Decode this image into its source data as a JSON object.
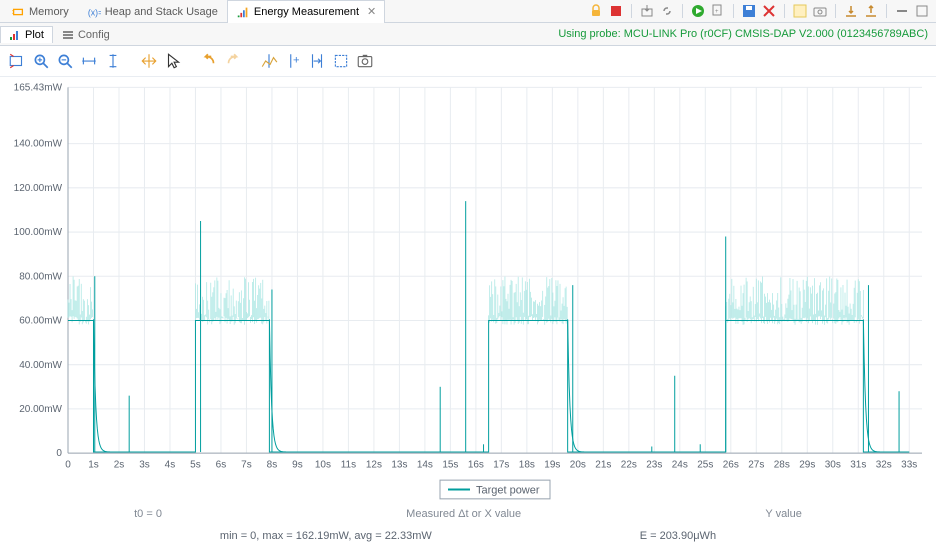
{
  "viewTabs": {
    "memory": "Memory",
    "heap": "Heap and Stack Usage",
    "energy": "Energy Measurement"
  },
  "innerTabs": {
    "plot": "Plot",
    "config": "Config"
  },
  "probe_status": "Using probe: MCU-LINK Pro (r0CF) CMSIS-DAP V2.000 (0123456789ABC)",
  "stats": {
    "t0": "t0 = 0",
    "measured": "Measured Δt or X value",
    "yvalue": "Y value",
    "range": "min = 0, max = 162.19mW, avg = 22.33mW",
    "energy": "E = 203.90μWh"
  },
  "legend": "Target power",
  "chart_data": {
    "type": "line",
    "title": "",
    "xlabel": "",
    "ylabel": "",
    "x_unit": "s",
    "y_unit": "mW",
    "xlim": [
      0,
      33.5
    ],
    "ylim": [
      0,
      165.43
    ],
    "yticks": [
      0,
      20.0,
      40.0,
      60.0,
      80.0,
      100.0,
      120.0,
      140.0,
      165.43
    ],
    "ytick_labels": [
      "0",
      "20.00mW",
      "40.00mW",
      "60.00mW",
      "80.00mW",
      "100.00mW",
      "120.00mW",
      "140.00mW",
      "165.43mW"
    ],
    "xticks": [
      0,
      1,
      2,
      3,
      4,
      5,
      6,
      7,
      8,
      9,
      10,
      11,
      12,
      13,
      14,
      15,
      16,
      17,
      18,
      19,
      20,
      21,
      22,
      23,
      24,
      25,
      26,
      27,
      28,
      29,
      30,
      31,
      32,
      33
    ],
    "xtick_labels": [
      "0",
      "1s",
      "2s",
      "3s",
      "4s",
      "5s",
      "6s",
      "7s",
      "8s",
      "9s",
      "10s",
      "11s",
      "12s",
      "13s",
      "14s",
      "15s",
      "16s",
      "17s",
      "18s",
      "19s",
      "20s",
      "21s",
      "22s",
      "23s",
      "24s",
      "25s",
      "26s",
      "27s",
      "28s",
      "29s",
      "30s",
      "31s",
      "32s",
      "33s"
    ],
    "series": [
      {
        "name": "Target power",
        "baseline_values": [
          [
            0.0,
            60
          ],
          [
            1.0,
            60
          ],
          [
            1.0,
            0.5
          ],
          [
            5.0,
            0.5
          ],
          [
            5.0,
            60
          ],
          [
            7.9,
            60
          ],
          [
            7.9,
            0.5
          ],
          [
            16.5,
            0.5
          ],
          [
            16.5,
            60
          ],
          [
            19.6,
            60
          ],
          [
            19.6,
            0.5
          ],
          [
            25.8,
            0.5
          ],
          [
            25.8,
            60
          ],
          [
            31.2,
            60
          ],
          [
            31.2,
            0.5
          ],
          [
            33.0,
            0.5
          ]
        ],
        "noise_high_intervals": [
          [
            0.0,
            1.0
          ],
          [
            5.0,
            7.9
          ],
          [
            16.5,
            19.6
          ],
          [
            25.8,
            31.2
          ]
        ],
        "noise_amplitude": [
          60,
          80
        ],
        "spikes": [
          {
            "x": 1.05,
            "y": 80
          },
          {
            "x": 2.4,
            "y": 26
          },
          {
            "x": 5.2,
            "y": 105
          },
          {
            "x": 8.0,
            "y": 74
          },
          {
            "x": 14.6,
            "y": 30
          },
          {
            "x": 15.6,
            "y": 114
          },
          {
            "x": 16.3,
            "y": 4
          },
          {
            "x": 19.8,
            "y": 76
          },
          {
            "x": 22.9,
            "y": 3
          },
          {
            "x": 23.8,
            "y": 35
          },
          {
            "x": 24.8,
            "y": 4
          },
          {
            "x": 25.8,
            "y": 98
          },
          {
            "x": 31.4,
            "y": 76
          },
          {
            "x": 32.6,
            "y": 28
          }
        ]
      }
    ],
    "grid": true,
    "legend_position": "bottom"
  }
}
